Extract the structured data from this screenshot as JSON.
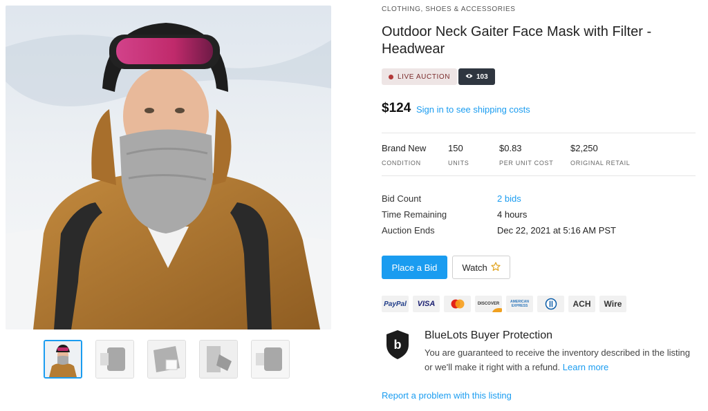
{
  "listing": {
    "category": "CLOTHING, SHOES & ACCESSORIES",
    "title": "Outdoor Neck Gaiter Face Mask with Filter - Headwear",
    "live_badge": "LIVE AUCTION",
    "views": "103",
    "price": "$124",
    "shipping_link": "Sign in to see shipping costs"
  },
  "specs": [
    {
      "value": "Brand New",
      "label": "CONDITION"
    },
    {
      "value": "150",
      "label": "UNITS"
    },
    {
      "value": "$0.83",
      "label": "PER UNIT COST"
    },
    {
      "value": "$2,250",
      "label": "ORIGINAL RETAIL"
    }
  ],
  "auction": {
    "bid_count_label": "Bid Count",
    "bid_count_value": "2 bids",
    "time_remaining_label": "Time Remaining",
    "time_remaining_value": "4 hours",
    "auction_ends_label": "Auction Ends",
    "auction_ends_value": "Dec 22, 2021 at 5:16 AM PST"
  },
  "actions": {
    "place_bid": "Place a Bid",
    "watch": "Watch"
  },
  "payments": [
    {
      "label": "PayPal",
      "icon": "paypal-icon"
    },
    {
      "label": "VISA",
      "icon": "visa-icon"
    },
    {
      "label": "",
      "icon": "mastercard-icon"
    },
    {
      "label": "DISCOVER",
      "icon": "discover-icon"
    },
    {
      "label": "AMERICAN EXPRESS",
      "icon": "amex-icon"
    },
    {
      "label": "",
      "icon": "diners-icon"
    },
    {
      "label": "ACH",
      "icon": "ach-icon"
    },
    {
      "label": "Wire",
      "icon": "wire-icon"
    }
  ],
  "protection": {
    "title": "BlueLots Buyer Protection",
    "text": "You are guaranteed to receive the inventory described in the listing or we'll make it right with a refund.",
    "learn_more": "Learn more"
  },
  "report_link": "Report a problem with this listing",
  "colors": {
    "accent": "#1a9cf0",
    "live_badge_bg": "#eee5e5",
    "live_dot": "#b23a3a",
    "views_badge_bg": "#2f3640"
  }
}
